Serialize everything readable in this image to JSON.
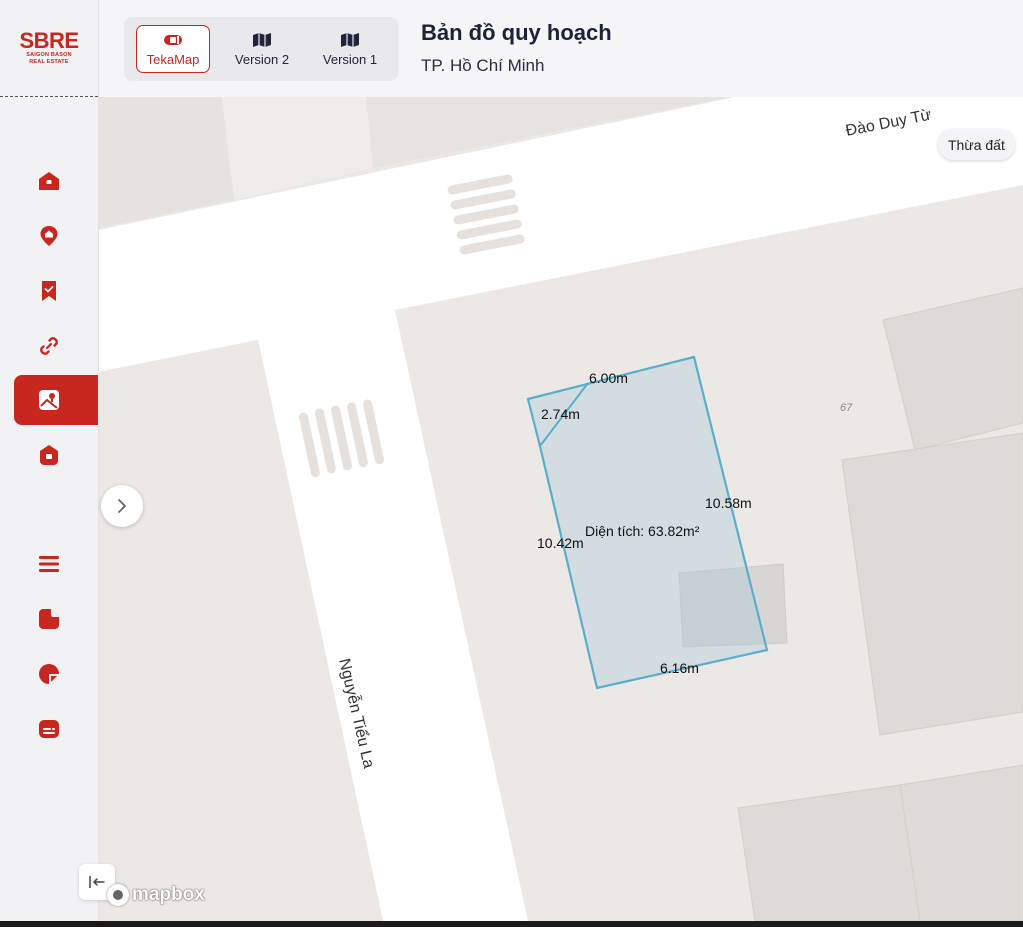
{
  "brand": {
    "logo_text": "SBRE",
    "logo_subtext": "SAIGON BASON\nREAL ESTATE",
    "accent": "#c8271e"
  },
  "header": {
    "map_options": [
      {
        "label": "TekaMap",
        "icon": "tekamap-icon",
        "active": true
      },
      {
        "label": "Version 2",
        "icon": "map-icon",
        "active": false
      },
      {
        "label": "Version 1",
        "icon": "map-icon",
        "active": false
      }
    ],
    "title": "Bản đồ quy hoạch",
    "subtitle": "TP. Hồ Chí Minh"
  },
  "sidebar": {
    "items": [
      {
        "icon": "home-icon",
        "active": false
      },
      {
        "icon": "location-home-icon",
        "active": false
      },
      {
        "icon": "bookmark-check-icon",
        "active": false
      },
      {
        "icon": "link-icon",
        "active": false
      },
      {
        "icon": "map-image-icon",
        "active": true
      },
      {
        "icon": "house-shield-icon",
        "active": false
      },
      {
        "icon": "menu-icon",
        "active": false
      },
      {
        "icon": "document-icon",
        "active": false
      },
      {
        "icon": "chart-pie-icon",
        "active": false
      },
      {
        "icon": "news-icon",
        "active": false
      }
    ]
  },
  "map": {
    "streets": [
      {
        "name": "Đào Duy Từ"
      },
      {
        "name": "Nguyễn Tiểu La"
      }
    ],
    "parcel_chip": "Thừa đất",
    "house_number": "67",
    "parcel": {
      "edges": [
        "6.00m",
        "2.74m",
        "10.58m",
        "10.42m",
        "6.16m"
      ],
      "area_label": "Diện tích: 63.82m²",
      "outline_color": "#5aaecb"
    },
    "attribution": "mapbox"
  }
}
